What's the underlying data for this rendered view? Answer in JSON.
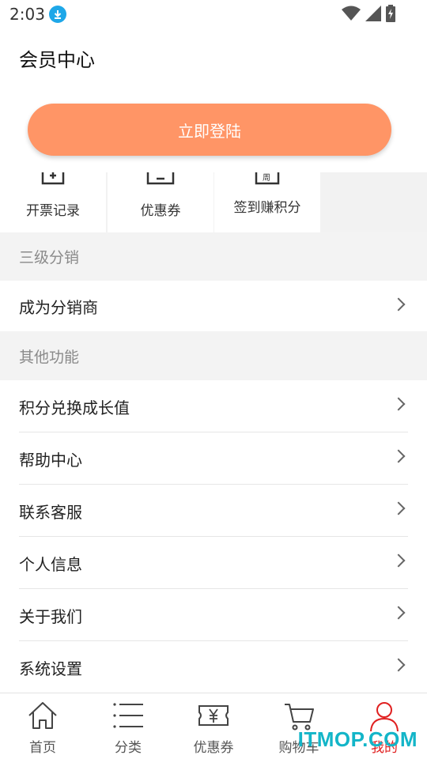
{
  "status": {
    "time": "2:03"
  },
  "header": {
    "title": "会员中心"
  },
  "login": {
    "label": "立即登陆"
  },
  "quick_actions": [
    {
      "label": "开票记录",
      "icon": "invoice-icon"
    },
    {
      "label": "优惠券",
      "icon": "coupon-icon"
    },
    {
      "label": "签到赚积分",
      "icon": "calendar-icon",
      "icon_text": "周"
    }
  ],
  "sections": {
    "distribution": {
      "title": "三级分销",
      "items": [
        {
          "label": "成为分销商"
        }
      ]
    },
    "other": {
      "title": "其他功能",
      "items": [
        {
          "label": "积分兑换成长值"
        },
        {
          "label": "帮助中心"
        },
        {
          "label": "联系客服"
        },
        {
          "label": "个人信息"
        },
        {
          "label": "关于我们"
        },
        {
          "label": "系统设置"
        }
      ]
    }
  },
  "tabs": [
    {
      "label": "首页",
      "icon": "home-icon"
    },
    {
      "label": "分类",
      "icon": "list-icon"
    },
    {
      "label": "优惠券",
      "icon": "coupon-icon"
    },
    {
      "label": "购物车",
      "icon": "cart-icon"
    },
    {
      "label": "我的",
      "icon": "user-icon",
      "active": true
    }
  ],
  "colors": {
    "accent": "#ff9566",
    "active_tab": "#e02020",
    "section_bg": "#f3f3f3"
  },
  "watermark": {
    "text": "ITMOP.COM"
  }
}
